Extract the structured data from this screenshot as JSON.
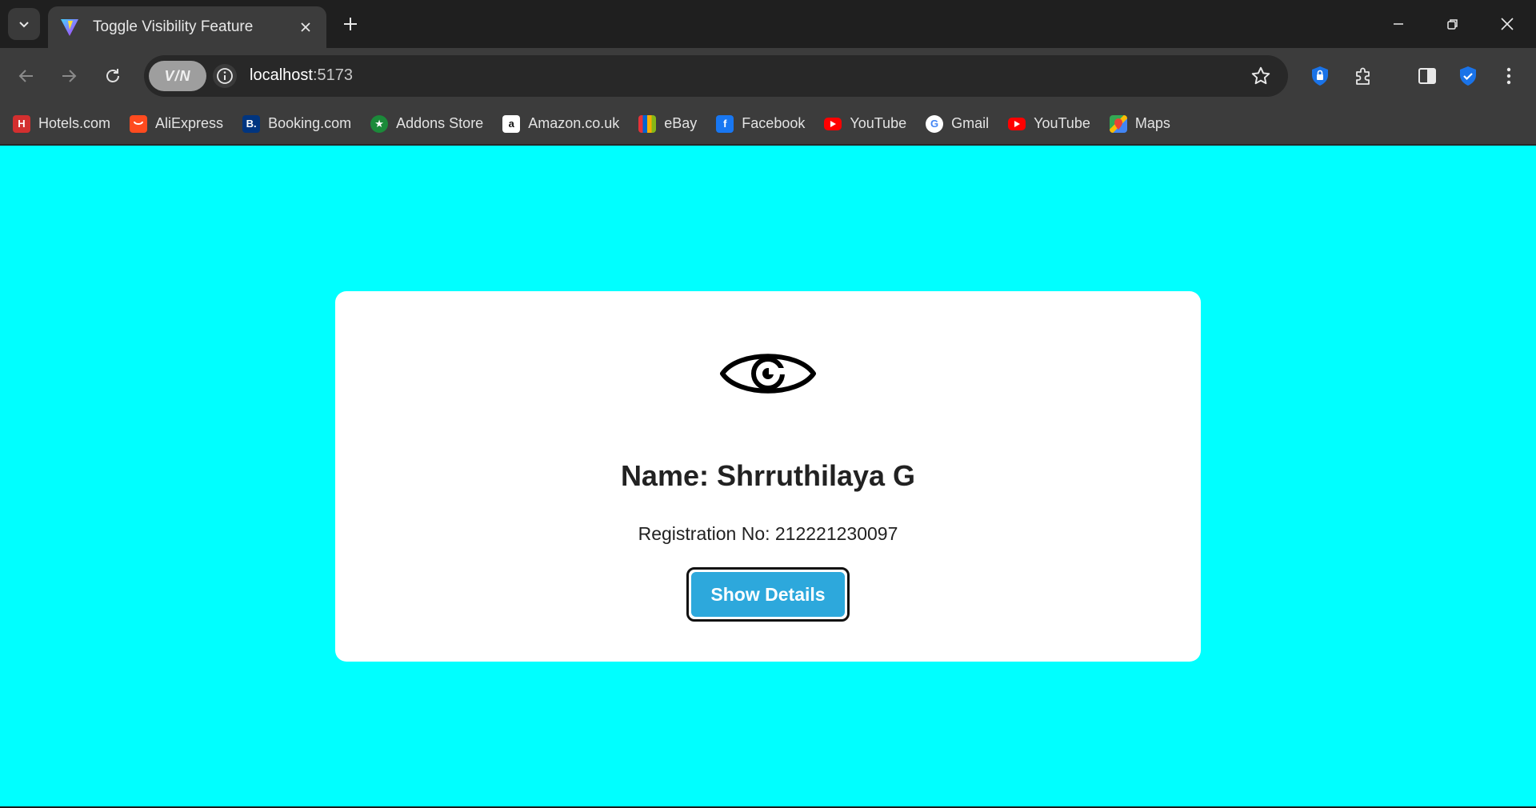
{
  "browser": {
    "tab": {
      "title": "Toggle Visibility Feature"
    },
    "omnibox": {
      "vpn_label": "V/N",
      "url_host": "localhost",
      "url_port": ":5173"
    },
    "bookmarks": [
      {
        "label": "Hotels.com",
        "icon": "hotels-icon",
        "color": "#d32f2f"
      },
      {
        "label": "AliExpress",
        "icon": "aliexpress-icon",
        "color": "#ff4b1f"
      },
      {
        "label": "Booking.com",
        "icon": "booking-icon",
        "color": "#003580"
      },
      {
        "label": "Addons Store",
        "icon": "addons-store-icon",
        "color": "#1b8a3a"
      },
      {
        "label": "Amazon.co.uk",
        "icon": "amazon-icon",
        "color": "#ffffff"
      },
      {
        "label": "eBay",
        "icon": "ebay-icon",
        "color": "#e53238"
      },
      {
        "label": "Facebook",
        "icon": "facebook-icon",
        "color": "#1877f2"
      },
      {
        "label": "YouTube",
        "icon": "youtube-icon",
        "color": "#ff0000"
      },
      {
        "label": "Gmail",
        "icon": "google-icon",
        "color": "#ffffff"
      },
      {
        "label": "YouTube",
        "icon": "youtube-icon",
        "color": "#ff0000"
      },
      {
        "label": "Maps",
        "icon": "maps-icon",
        "color": "#34a853"
      }
    ]
  },
  "page": {
    "background": "#00ffff",
    "card": {
      "icon": "eye-icon",
      "name": "Name: Shrruthilaya G",
      "registration": "Registration No: 212221230097",
      "button_label": "Show Details",
      "button_color": "#2da8dc"
    }
  }
}
